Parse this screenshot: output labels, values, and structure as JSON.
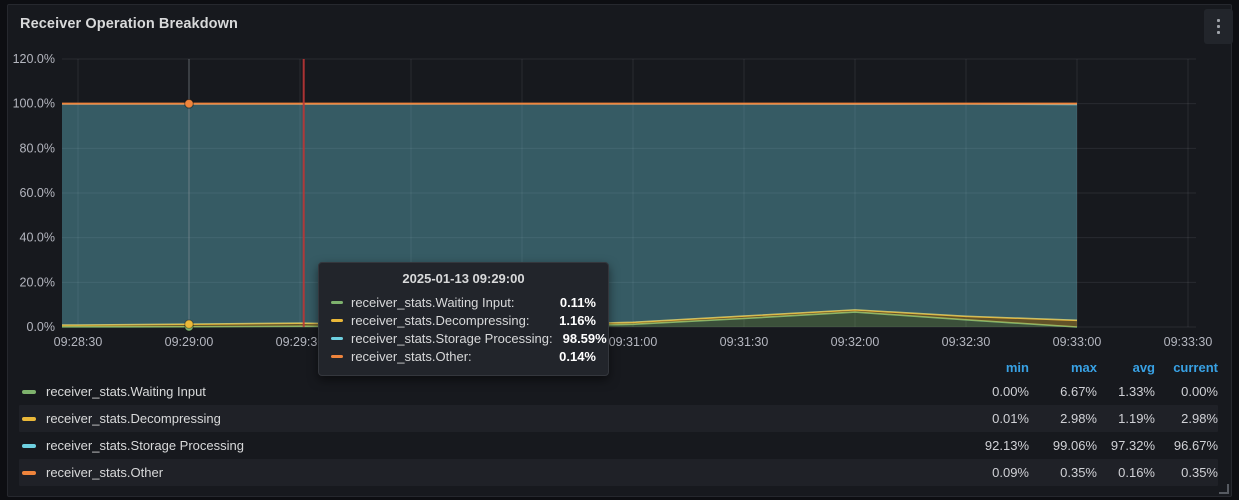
{
  "panel": {
    "title": "Receiver Operation Breakdown",
    "menu_icon": "kebab-menu-icon"
  },
  "colors": {
    "green": "#7EB26D",
    "yellow": "#EAB839",
    "cyan": "#6ED0E0",
    "orange": "#EF843C",
    "annotation_red": "#bb3535",
    "legend_header_blue": "#38a1e4",
    "panel_bg": "#17191e",
    "grid": "rgba(204,204,220,0.10)",
    "axis_text": "#b4b6bf"
  },
  "chart_data": {
    "type": "area",
    "stacked": true,
    "unit": "percent",
    "title": "Receiver Operation Breakdown",
    "ylim": [
      0,
      120
    ],
    "y_ticks": [
      "0.0%",
      "20.0%",
      "40.0%",
      "60.0%",
      "80.0%",
      "100.0%",
      "120.0%"
    ],
    "x_axis_ticks": [
      "09:28:30",
      "09:29:00",
      "09:29:30",
      "09:30:00",
      "09:30:30",
      "09:31:00",
      "09:31:30",
      "09:32:00",
      "09:32:30",
      "09:33:00",
      "09:33:30"
    ],
    "x": [
      "09:28:30",
      "09:29:00",
      "09:29:30",
      "09:30:00",
      "09:30:30",
      "09:31:00",
      "09:31:30",
      "09:32:00",
      "09:32:30",
      "09:33:00"
    ],
    "series": [
      {
        "name": "receiver_stats.Waiting Input",
        "color": "#7EB26D",
        "values": [
          0.1,
          0.11,
          0.3,
          0.15,
          0.1,
          1.2,
          3.8,
          6.67,
          3.2,
          0.0
        ]
      },
      {
        "name": "receiver_stats.Decompressing",
        "color": "#EAB839",
        "values": [
          0.75,
          1.16,
          1.4,
          0.9,
          0.75,
          0.9,
          1.1,
          1.0,
          1.6,
          2.98
        ]
      },
      {
        "name": "receiver_stats.Storage Processing",
        "color": "#6ED0E0",
        "values": [
          99.03,
          98.59,
          98.15,
          98.85,
          99.06,
          97.8,
          94.98,
          92.13,
          95.05,
          96.67
        ]
      },
      {
        "name": "receiver_stats.Other",
        "color": "#EF843C",
        "values": [
          0.12,
          0.14,
          0.15,
          0.1,
          0.09,
          0.1,
          0.12,
          0.2,
          0.15,
          0.35
        ]
      }
    ],
    "annotation": {
      "time": "09:29:31",
      "color": "#bb3535"
    },
    "crosshair_time": "09:29:00",
    "hover_time": "09:29:00",
    "legend_position": "bottom-table",
    "grid": true
  },
  "tooltip": {
    "timestamp": "2025-01-13 09:29:00",
    "rows": [
      {
        "label": "receiver_stats.Waiting Input:",
        "value": "0.11%",
        "color": "#7EB26D"
      },
      {
        "label": "receiver_stats.Decompressing:",
        "value": "1.16%",
        "color": "#EAB839"
      },
      {
        "label": "receiver_stats.Storage Processing:",
        "value": "98.59%",
        "color": "#6ED0E0"
      },
      {
        "label": "receiver_stats.Other:",
        "value": "0.14%",
        "color": "#EF843C"
      }
    ]
  },
  "legend": {
    "headers": [
      "min",
      "max",
      "avg",
      "current"
    ],
    "rows": [
      {
        "name": "receiver_stats.Waiting Input",
        "color": "#7EB26D",
        "min": "0.00%",
        "max": "6.67%",
        "avg": "1.33%",
        "current": "0.00%",
        "striped": false
      },
      {
        "name": "receiver_stats.Decompressing",
        "color": "#EAB839",
        "min": "0.01%",
        "max": "2.98%",
        "avg": "1.19%",
        "current": "2.98%",
        "striped": true
      },
      {
        "name": "receiver_stats.Storage Processing",
        "color": "#6ED0E0",
        "min": "92.13%",
        "max": "99.06%",
        "avg": "97.32%",
        "current": "96.67%",
        "striped": false
      },
      {
        "name": "receiver_stats.Other",
        "color": "#EF843C",
        "min": "0.09%",
        "max": "0.35%",
        "avg": "0.16%",
        "current": "0.35%",
        "striped": true
      }
    ]
  }
}
